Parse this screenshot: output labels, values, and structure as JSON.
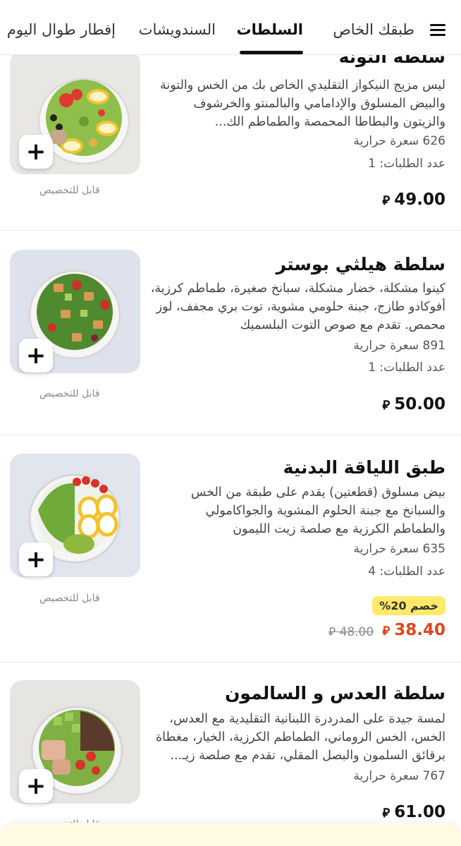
{
  "tabs": [
    {
      "label": "طبقك الخاص",
      "active": false
    },
    {
      "label": "السلطات",
      "active": true
    },
    {
      "label": "السندويشات",
      "active": false
    },
    {
      "label": "إفطار طوال اليوم",
      "active": false
    }
  ],
  "items": [
    {
      "title": "سلطة التونة",
      "description": "ليس مزيج النيكواز التقليدي الخاص بك من الخس والتونة والبيض المسلوق والإدامامي والبالمنتو والخرشوف والزيتون والبطاطا المحمصة والطماطم الك...",
      "calories": "626 سعرة حرارية",
      "orders": "عدد الطلبات: 1",
      "price": "49.00",
      "customizable": "قابل للتخصيص"
    },
    {
      "title": "سلطة هيلثي بوستر",
      "description": "كينوا مشكلة، خضار مشكلة، سبانخ صغيرة، طماطم كرزية، أفوكادو طازج، جبنة حلومي مشوية، توت بري مجفف، لوز محمص. تقدم مع صوص التوت البلسميك",
      "calories": "891 سعرة حرارية",
      "orders": "عدد الطلبات: 1",
      "price": "50.00",
      "customizable": "قابل للتخصيص"
    },
    {
      "title": "طبق اللياقة البدنية",
      "description": "بيض مسلوق (قطعتين) يقدم على طبقة من الخس والسبانخ مع جبنة الحلوم المشوية والجواكامولي والطماطم الكرزية مع صلصة زيت الليمون",
      "calories": "635 سعرة حرارية",
      "orders": "عدد الطلبات: 4",
      "badge": "خصم 20%",
      "price": "38.40",
      "old_price": "48.00",
      "customizable": "قابل للتخصيص"
    },
    {
      "title": "سلطة العدس و السالمون",
      "description": "لمسة جيدة على المدردرة اللبنانية التقليدية مع العدس، الخس، الخس الروماني، الطماطم الكرزية، الخيار، مغطاة برقائق السلمون والبصل المقلي، تقدم مع صلصة زيـ...",
      "calories": "767 سعرة حرارية",
      "price": "61.00",
      "customizable": "قابل للتخصيص"
    }
  ],
  "currency_symbol": "⃁",
  "add_symbol": "+",
  "colors": {
    "accent_discount": "#e0451b",
    "badge_bg": "#ffe96b"
  }
}
